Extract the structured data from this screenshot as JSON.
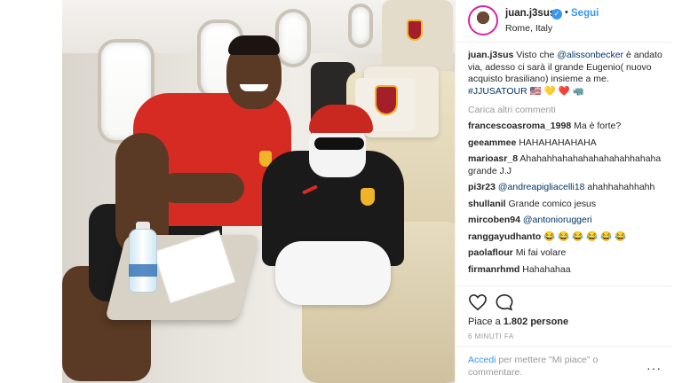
{
  "post": {
    "username": "juan.j3sus",
    "verified_mark": "✓",
    "separator": "•",
    "follow_label": "Segui",
    "location": "Rome, Italy"
  },
  "caption": {
    "username": "juan.j3sus",
    "text_before": "Visto che ",
    "mention": "@alissonbecker",
    "text_after": " è andato via, adesso ci sarà il grande Eugenio( nuovo acquisto brasiliano) insieme a me. ",
    "hashtag": "#JJUSATOUR",
    "emojis": "🇺🇸 💛 ❤️ 🦏"
  },
  "load_more": "Carica altri commenti",
  "comments": [
    {
      "user": "francescoasroma_1998",
      "text": "Ma è forte?"
    },
    {
      "user": "geeammee",
      "text": "HAHAHAHAHAHA"
    },
    {
      "user": "marioasr_8",
      "text": "Ahahahhahahahahahahahhahaha grande J.J"
    },
    {
      "user": "pi3r23",
      "mention": "@andreapigliacelli18",
      "text": "ahahhahahhahh"
    },
    {
      "user": "shullanil",
      "text": "Grande comico jesus"
    },
    {
      "user": "mircoben94",
      "mention": "@antonioruggeri",
      "text": ""
    },
    {
      "user": "ranggayudhanto",
      "text": "😂 😂 😂 😂 😂 😂"
    },
    {
      "user": "paolaflour",
      "text": "Mi fai volare"
    },
    {
      "user": "firmanrhmd",
      "text": "Hahahahaa"
    }
  ],
  "likes": {
    "prefix": "Piace a ",
    "count": "1.802",
    "suffix": " persone"
  },
  "time_ago": "6 MINUTI FA",
  "footer": {
    "login_label": "Accedi",
    "text": " per mettere \"Mi piace\" o commentare.",
    "more_label": "···"
  },
  "colors": {
    "accent": "#3897f0",
    "text": "#262626",
    "muted": "#999999",
    "roma": "#a41f2a",
    "gold": "#f0b429"
  },
  "icons": {
    "like": "heart-icon",
    "comment": "comment-bubble-icon",
    "verified": "verified-badge-icon",
    "more": "more-options-icon"
  }
}
